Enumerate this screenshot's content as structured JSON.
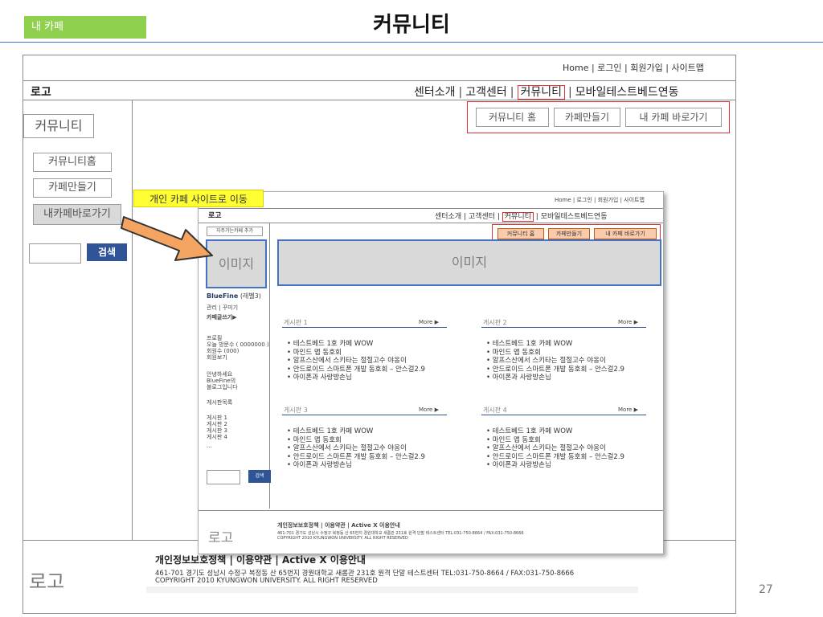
{
  "slide": {
    "tag": "내 카페",
    "title": "커뮤니티",
    "page_number": "27"
  },
  "topmenu": "Home | 로그인 | 회원가입 | 사이트맵",
  "header": {
    "logo": "로고",
    "nav": [
      "센터소개",
      "고객센터",
      "커뮤니티",
      "모바일테스트베드연동"
    ]
  },
  "subnav": [
    "커뮤니티 홈",
    "카페만들기",
    "내 카페 바로가기"
  ],
  "sidebar": {
    "title": "커뮤니티",
    "items": [
      "커뮤니티홈",
      "카페만들기",
      "내카페바로가기"
    ],
    "search_button": "검색"
  },
  "callout": "개인 카페 사이트로 이동",
  "footer": {
    "logo": "로고",
    "links": "개인정보보호정책 | 이용약관 | Active X 이용안내",
    "address": "461-701 경기도 성남시 수정구 복정동 산 65번지 경원대학교 새롬관 231호 원격 단말 테스트센터 TEL:031-750-8664 / FAX:031-750-8666",
    "copyright": "COPYRIGHT 2010 KYUNGWON UNIVERSITY. ALL RIGHT RESERVED"
  },
  "inner": {
    "topmenu": "Home | 로그인 | 회원가입 | 사이트맵",
    "logo": "로고",
    "nav": [
      "센터소개",
      "고객센터",
      "커뮤니티",
      "모바일테스트베드연동"
    ],
    "subnav": [
      "커뮤니티 홈",
      "카페만들기",
      "내 카페 바로가기"
    ],
    "favorite_button": "자주가는카페 추가",
    "left_image": "이미지",
    "banner_image": "이미지",
    "cafe_name": "BlueFine",
    "cafe_level": "(레벨3)",
    "manage": "관리 | 꾸미기",
    "write": "카페글쓰기▶",
    "profile_title": "프로필",
    "visitors": "오늘 방문수 ( 0000000 )",
    "members": "회원수 (000)",
    "member_view": "회원보기",
    "greeting1": "안녕하세요",
    "greeting2": "BlueFine의",
    "greeting3": "블로그입니다",
    "board_list_title": "게시판목록",
    "board_links": [
      "게시판 1",
      "게시판 2",
      "게시판 3",
      "게시판 4",
      "..."
    ],
    "search_button": "검색",
    "more": "More ▶",
    "boards": [
      {
        "title": "게시판 1",
        "items": [
          "테스트베드 1호 카페 WOW",
          "마인드 맵 동호회",
          "알프스산에서 스키타는 절절고수 야옹이",
          "안드로이드 스마트폰 개발 동호회 – 안스걸2.9",
          "아이폰과 사랑방손님"
        ]
      },
      {
        "title": "게시판 2",
        "items": [
          "테스트베드 1호 카페 WOW",
          "마인드 맵 동호회",
          "알프스산에서 스키타는 절절고수 야옹이",
          "안드로이드 스마트폰 개발 동호회 – 안스걸2.9",
          "아이폰과 사랑방손님"
        ]
      },
      {
        "title": "게시판 3",
        "items": [
          "테스트베드 1호 카페 WOW",
          "마인드 맵 동호회",
          "알프스산에서 스키타는 절절고수 야옹이",
          "안드로이드 스마트폰 개발 동호회 – 안스걸2.9",
          "아이폰과 사랑방손님"
        ]
      },
      {
        "title": "게시판 4",
        "items": [
          "테스트베드 1호 카페 WOW",
          "마인드 맵 동호회",
          "알프스산에서 스키타는 절절고수 야옹이",
          "안드로이드 스마트폰 개발 동호회 – 안스걸2.9",
          "아이폰과 사랑방손님"
        ]
      }
    ],
    "footer": {
      "logo": "로고",
      "links": "개인정보보호정책 | 이용약관 | Active X 이용안내",
      "address": "461-701 경기도 성남시 수정구 복정동 산 65번지 경원대학교 새롬관 231호 원격 단말 테스트센터 TEL:031-750-8664 / FAX:031-750-8666",
      "copyright": "COPYRIGHT 2010 KYUNGWON UNIVERSITY. ALL RIGHT RESERVED"
    }
  },
  "colors": {
    "tag_bg": "#8fd14f",
    "highlight_border": "#dd3333",
    "search_button": "#2f5597",
    "callout_bg": "#ffff33",
    "arrow_fill": "#f4a460",
    "image_border": "#4472c4",
    "orange_button": "#f8cbad"
  }
}
